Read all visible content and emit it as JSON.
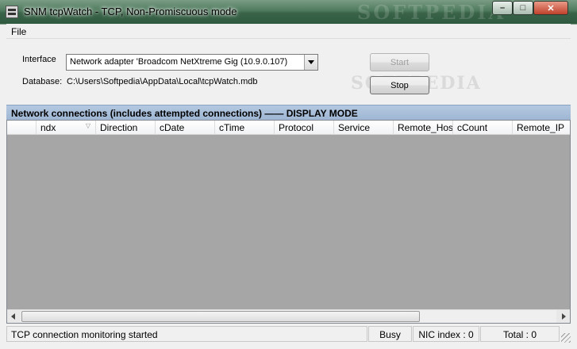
{
  "window": {
    "title": "SNM tcpWatch - TCP, Non-Promiscuous mode",
    "watermark": "SOFTPEDIA",
    "controls": {
      "minimize": "–",
      "maximize": "□",
      "close": "✕"
    }
  },
  "menu": {
    "file": "File"
  },
  "form": {
    "interface_label": "Interface",
    "interface_value": "Network adapter 'Broadcom NetXtreme Gig (10.9.0.107)",
    "database_label": "Database:",
    "database_path": "C:\\Users\\Softpedia\\AppData\\Local\\tcpWatch.mdb",
    "start_label": "Start",
    "stop_label": "Stop",
    "watermark2": "SOFTPEDIA"
  },
  "section": {
    "title": "Network connections (includes attempted connections)  ——  DISPLAY MODE"
  },
  "list": {
    "columns": [
      "",
      "ndx",
      "Direction",
      "cDate",
      "cTime",
      "Protocol",
      "Service",
      "Remote_Host",
      "cCount",
      "Remote_IP"
    ],
    "sort_indicator": "▽"
  },
  "status": {
    "message": "TCP connection monitoring started",
    "busy": "Busy",
    "nic_index": "NIC index : 0",
    "total": "Total : 0"
  }
}
